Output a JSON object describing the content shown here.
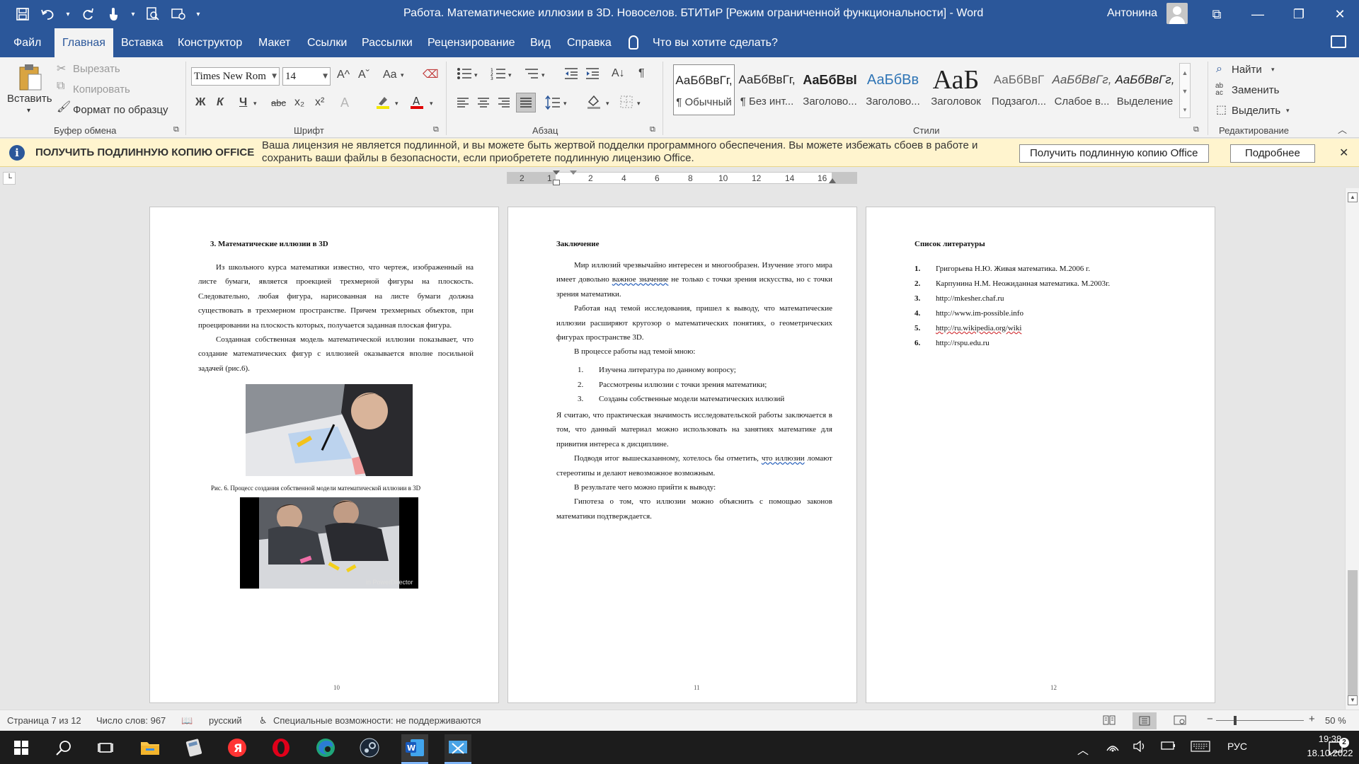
{
  "window": {
    "title": "Работа. Математические иллюзии в 3D. Новоселов. БТИТиР [Режим ограниченной функциональности]  -  Word",
    "user": "Антонина",
    "controls": {
      "ribbon_display": "⧉",
      "minimize": "—",
      "restore": "❐",
      "close": "✕"
    }
  },
  "qat": {
    "save": "🖫",
    "undo": "↶",
    "redo": "↻",
    "touch": "☝",
    "print_preview": "🔍",
    "customize": "▾"
  },
  "tabs": [
    "Файл",
    "Главная",
    "Вставка",
    "Конструктор",
    "Макет",
    "Ссылки",
    "Рассылки",
    "Рецензирование",
    "Вид",
    "Справка"
  ],
  "active_tab": "Главная",
  "tell_me": "Что вы хотите сделать?",
  "ribbon": {
    "clipboard": {
      "label": "Буфер обмена",
      "paste": "Вставить",
      "cut": "Вырезать",
      "copy": "Копировать",
      "format_painter": "Формат по образцу"
    },
    "font": {
      "label": "Шрифт",
      "name": "Times New Rom",
      "size": "14",
      "bold": "Ж",
      "italic": "К",
      "underline": "Ч",
      "strike": "abc",
      "subscript": "x₂",
      "superscript": "x²",
      "grow": "A^",
      "shrink": "Aˇ",
      "case": "Aa"
    },
    "paragraph": {
      "label": "Абзац",
      "sort": "A↓",
      "pilcrow": "¶"
    },
    "styles": {
      "label": "Стили",
      "items": [
        {
          "preview": "АаБбВвГг,",
          "name": "¶ Обычный",
          "selected": true
        },
        {
          "preview": "АаБбВвГг,",
          "name": "¶ Без инт..."
        },
        {
          "preview": "АаБбВвI",
          "name": "Заголово..."
        },
        {
          "preview": "АаБбВв",
          "name": "Заголово..."
        },
        {
          "preview": "АаБ",
          "name": "Заголовок"
        },
        {
          "preview": "АаБбВвГ",
          "name": "Подзагол..."
        },
        {
          "preview": "АаБбВвГг,",
          "name": "Слабое в..."
        },
        {
          "preview": "АаБбВвГг,",
          "name": "Выделение"
        }
      ]
    },
    "editing": {
      "label": "Редактирование",
      "find": "Найти",
      "replace": "Заменить",
      "select": "Выделить"
    }
  },
  "message_bar": {
    "title": "ПОЛУЧИТЬ ПОДЛИННУЮ КОПИЮ OFFICE",
    "text": "Ваша лицензия не является подлинной, и вы можете быть жертвой подделки программного обеспечения. Вы можете избежать сбоев в работе и сохранить ваши файлы в безопасности, если приобретете подлинную лицензию Office.",
    "button_primary": "Получить подлинную копию Office",
    "button_more": "Подробнее",
    "close": "✕"
  },
  "ruler": {
    "numbers": [
      "2",
      "1",
      "2",
      "4",
      "6",
      "8",
      "10",
      "12",
      "14",
      "16"
    ]
  },
  "pages": {
    "p10": {
      "heading": "3.  Математические иллюзии в 3D",
      "para1": "Из школьного курса  математики известно, что чертеж, изображенный на листе бумаги, является проекцией трехмерной фигуры на плоскость. Следовательно, любая фигура, нарисованная на листе бумаги должна существовать в трехмерном пространстве. Причем трехмерных объектов, при проецировании на плоскость которых, получается заданная плоская фигура.",
      "para2": "Созданная собственная модель математической иллюзии  показывает, что создание математических фигур с иллюзией оказывается вполне посильной задачей (рис.6).",
      "caption": "Рис. 6. Процесс создания собственной модели математической иллюзии в 3D",
      "watermark": "in PowerDirector",
      "page_number": "10"
    },
    "p11": {
      "heading": "Заключение",
      "para1_a": "Мир иллюзий чрезвычайно интересен и многообразен. Изучение этого мира имеет довольно ",
      "para1_b": "важное  значение",
      "para1_c": " не только с точки зрения искусства, но с точки зрения математики.",
      "para2": "Работая   над темой исследования, пришел к выводу, что математические иллюзии расширяют кругозор о математических понятиях, о геометрических фигурах пространстве 3D.",
      "para3": "В процессе работы над темой мною:",
      "list": [
        "Изучена литература по данному вопросу;",
        "Рассмотрены иллюзии с точки зрения математики;",
        "Созданы собственные модели математических иллюзий"
      ],
      "para4": "Я считаю, что практическая значимость исследовательской работы заключается в том, что данный материал можно использовать на занятиях математике для привития интереса к дисциплине.",
      "para5_a": "Подводя итог вышесказанному, хотелось бы отметить, ",
      "para5_b": "что  иллюзии",
      "para5_c": " ломают стереотипы и делают невозможное возможным.",
      "para6": "В результате чего можно прийти к выводу:",
      "para7": "Гипотеза о том, что иллюзии можно объяснить с помощью законов математики подтверждается.",
      "page_number": "11"
    },
    "p12": {
      "heading": "Список литературы",
      "list": [
        "Григорьева Н.Ю. Живая математика. М.2006 г.",
        "Карпунина Н.М. Неожиданная математика. М.2003г.",
        "http://mkesher.chaf.ru",
        "http://www.im-possible.info",
        "http://ru.wikipedia.org/wiki",
        "http://rspu.edu.ru"
      ],
      "page_number": "12"
    }
  },
  "status": {
    "page": "Страница 7 из 12",
    "words": "Число слов: 967",
    "language": "русский",
    "accessibility": "Специальные возможности: не поддерживаются",
    "zoom_minus": "−",
    "zoom_plus": "+",
    "zoom": "50 %",
    "zoom_fraction": 0.2
  },
  "taskbar": {
    "language": "РУС",
    "time": "19:38",
    "date": "18.10.2022",
    "notifications": "2"
  },
  "colors": {
    "word_blue": "#2b579a",
    "warning_bar": "#fff4ce",
    "yandex_red": "#ff3333",
    "opera_red": "#e0001a",
    "edge_teal": "#1fa57a"
  }
}
